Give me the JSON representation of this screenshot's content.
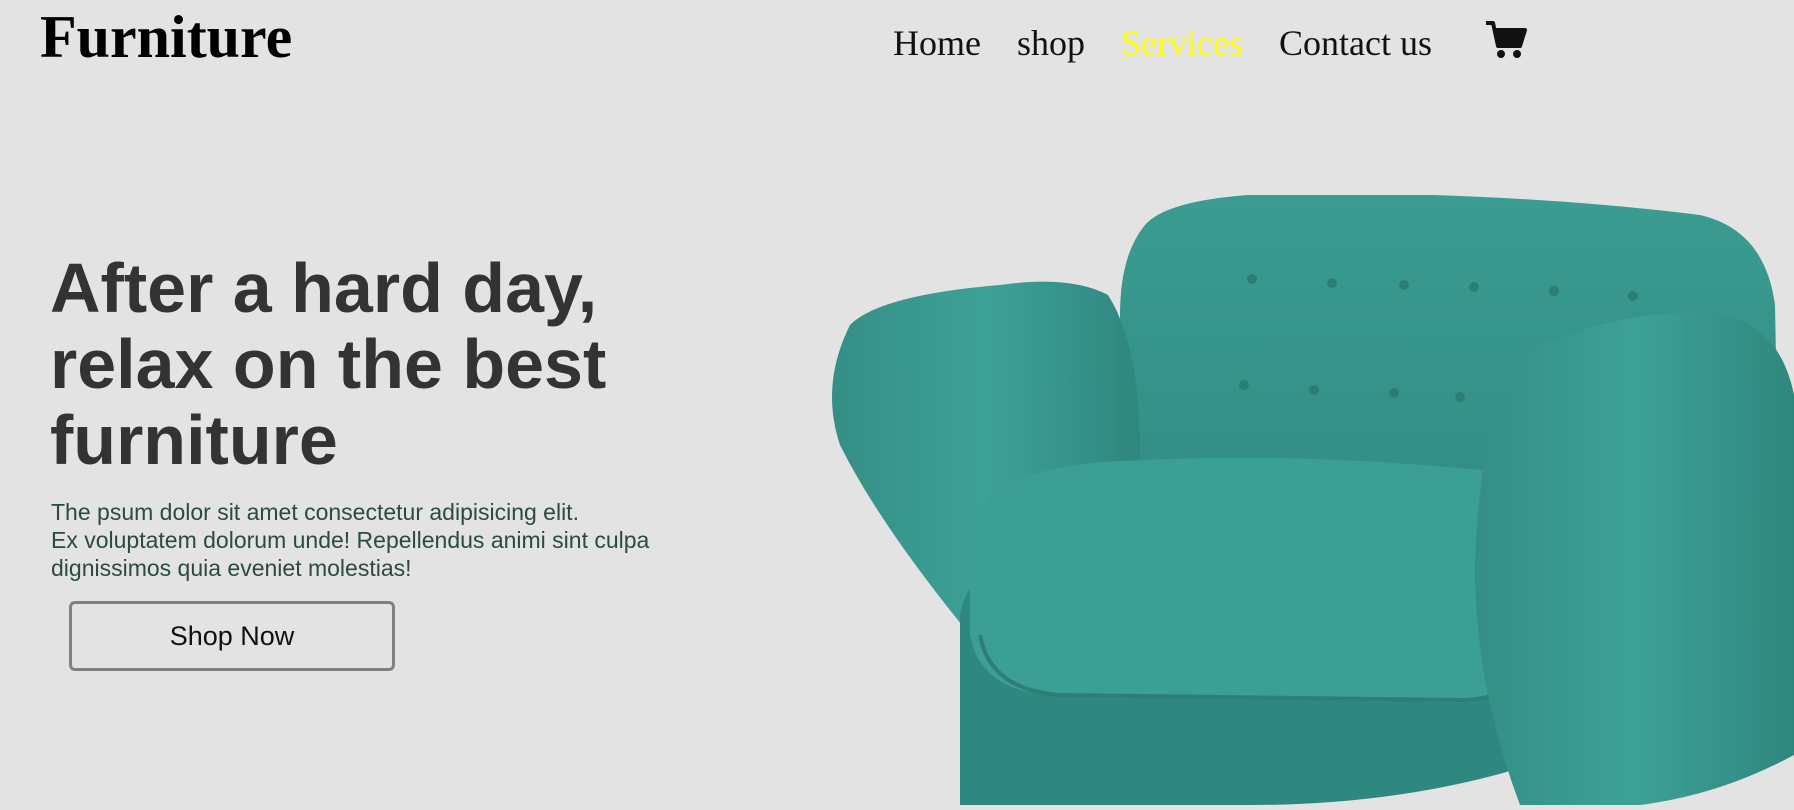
{
  "header": {
    "logo": "Furniture",
    "nav": [
      {
        "label": "Home"
      },
      {
        "label": "shop"
      },
      {
        "label": "Services"
      },
      {
        "label": "Contact us"
      }
    ],
    "active_nav": "Services",
    "cart_icon": "shopping-cart-icon"
  },
  "hero": {
    "title_lines": [
      "After a hard day,",
      "relax on the best",
      "furniture"
    ],
    "text_lines": [
      "The psum dolor sit amet consectetur adipisicing elit.",
      "Ex voluptatem dolorum unde! Repellendus animi sint culpa",
      "dignissimos quia eveniet molestias!"
    ],
    "button_label": "Shop Now",
    "image": "teal-armchair"
  },
  "colors": {
    "background": "#e3e3e3",
    "active_nav": "#ffff00",
    "title": "#333333",
    "chair": "#3a9a90"
  }
}
